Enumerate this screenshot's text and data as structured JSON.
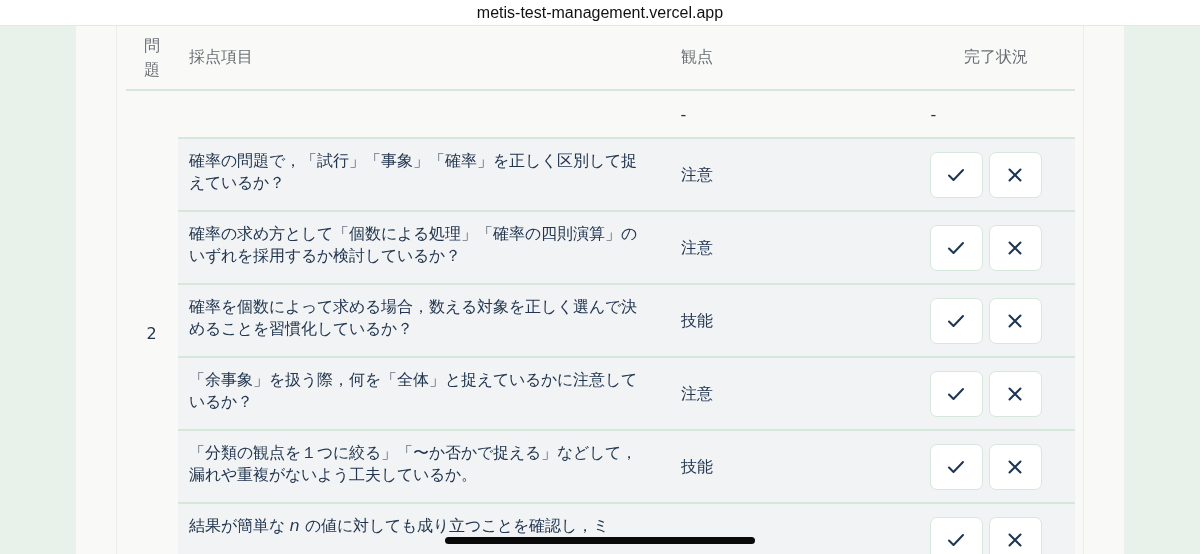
{
  "browser": {
    "url": "metis-test-management.vercel.app"
  },
  "table": {
    "columns": [
      "問題",
      "採点項目",
      "観点",
      "完了状況"
    ],
    "question": "2",
    "summary": {
      "viewpoint": "-",
      "status": "-"
    },
    "rows": [
      {
        "item": "確率の問題で，「試行」「事象」「確率」を正しく区別して捉えているか？",
        "viewpoint": "注意"
      },
      {
        "item": "確率の求め方として「個数による処理」「確率の四則演算」のいずれを採用するか検討しているか？",
        "viewpoint": "注意"
      },
      {
        "item": "確率を個数によって求める場合，数える対象を正しく選んで決めることを習慣化しているか？",
        "viewpoint": "技能"
      },
      {
        "item": "「余事象」を扱う際，何を「全体」と捉えているかに注意しているか？",
        "viewpoint": "注意"
      },
      {
        "item": "「分類の観点を１つに絞る」「〜か否かで捉える」などして，漏れや重複がないよう工夫しているか。",
        "viewpoint": "技能"
      },
      {
        "item": "結果が簡単な *n* の値に対しても成り立つことを確認し，ミ"
      }
    ]
  }
}
